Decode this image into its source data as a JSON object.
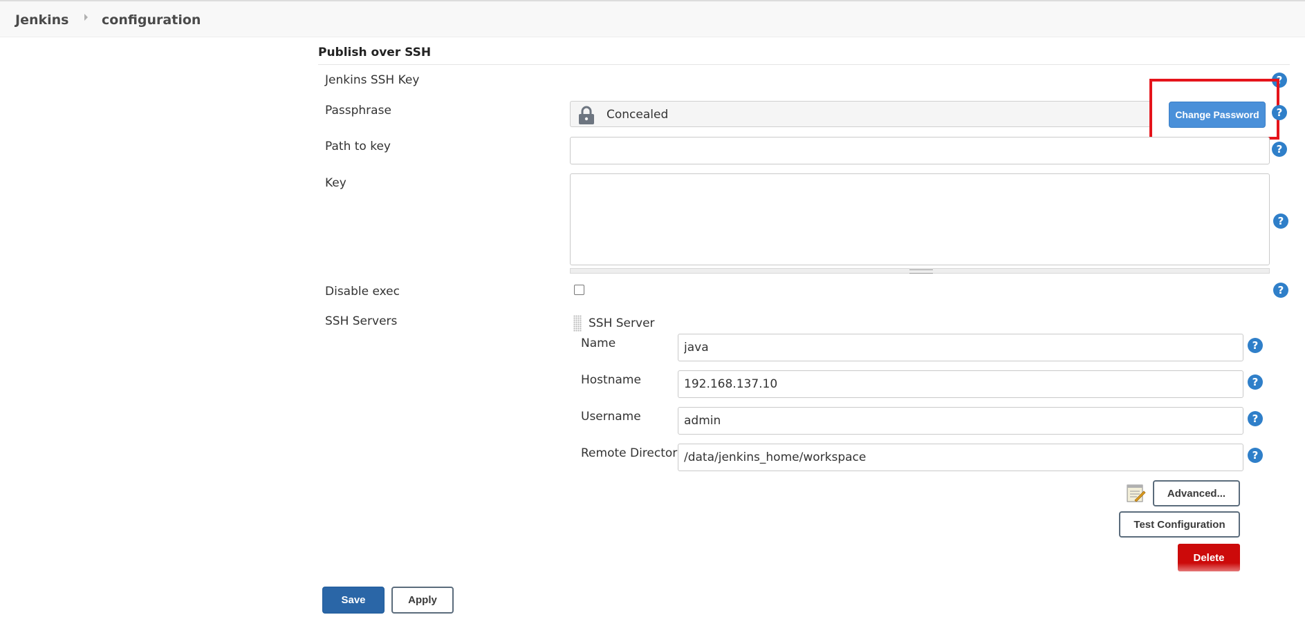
{
  "breadcrumb": {
    "root": "Jenkins",
    "current": "configuration"
  },
  "section": {
    "title": "Publish over SSH"
  },
  "fields": {
    "ssh_key_label": "Jenkins SSH Key",
    "passphrase_label": "Passphrase",
    "passphrase_value": "Concealed",
    "change_password_label": "Change Password",
    "path_to_key_label": "Path to key",
    "path_to_key_value": "",
    "key_label": "Key",
    "key_value": "",
    "disable_exec_label": "Disable exec",
    "disable_exec_checked": false,
    "ssh_servers_label": "SSH Servers"
  },
  "ssh_server": {
    "heading": "SSH Server",
    "name_label": "Name",
    "name_value": "java",
    "hostname_label": "Hostname",
    "hostname_value": "192.168.137.10",
    "username_label": "Username",
    "username_value": "admin",
    "remote_dir_label": "Remote Directory",
    "remote_dir_value": "/data/jenkins_home/workspace",
    "advanced_label": "Advanced...",
    "test_label": "Test Configuration",
    "delete_label": "Delete"
  },
  "footer": {
    "save_label": "Save",
    "apply_label": "Apply"
  },
  "icons": {
    "help": "help-icon",
    "lock": "lock-icon",
    "notepad": "notepad-icon",
    "drag": "drag-handle-icon"
  },
  "colors": {
    "primary": "#2a66a7",
    "help": "#2f7fc9",
    "danger": "#cc0a0a",
    "highlight": "#e5141b"
  }
}
